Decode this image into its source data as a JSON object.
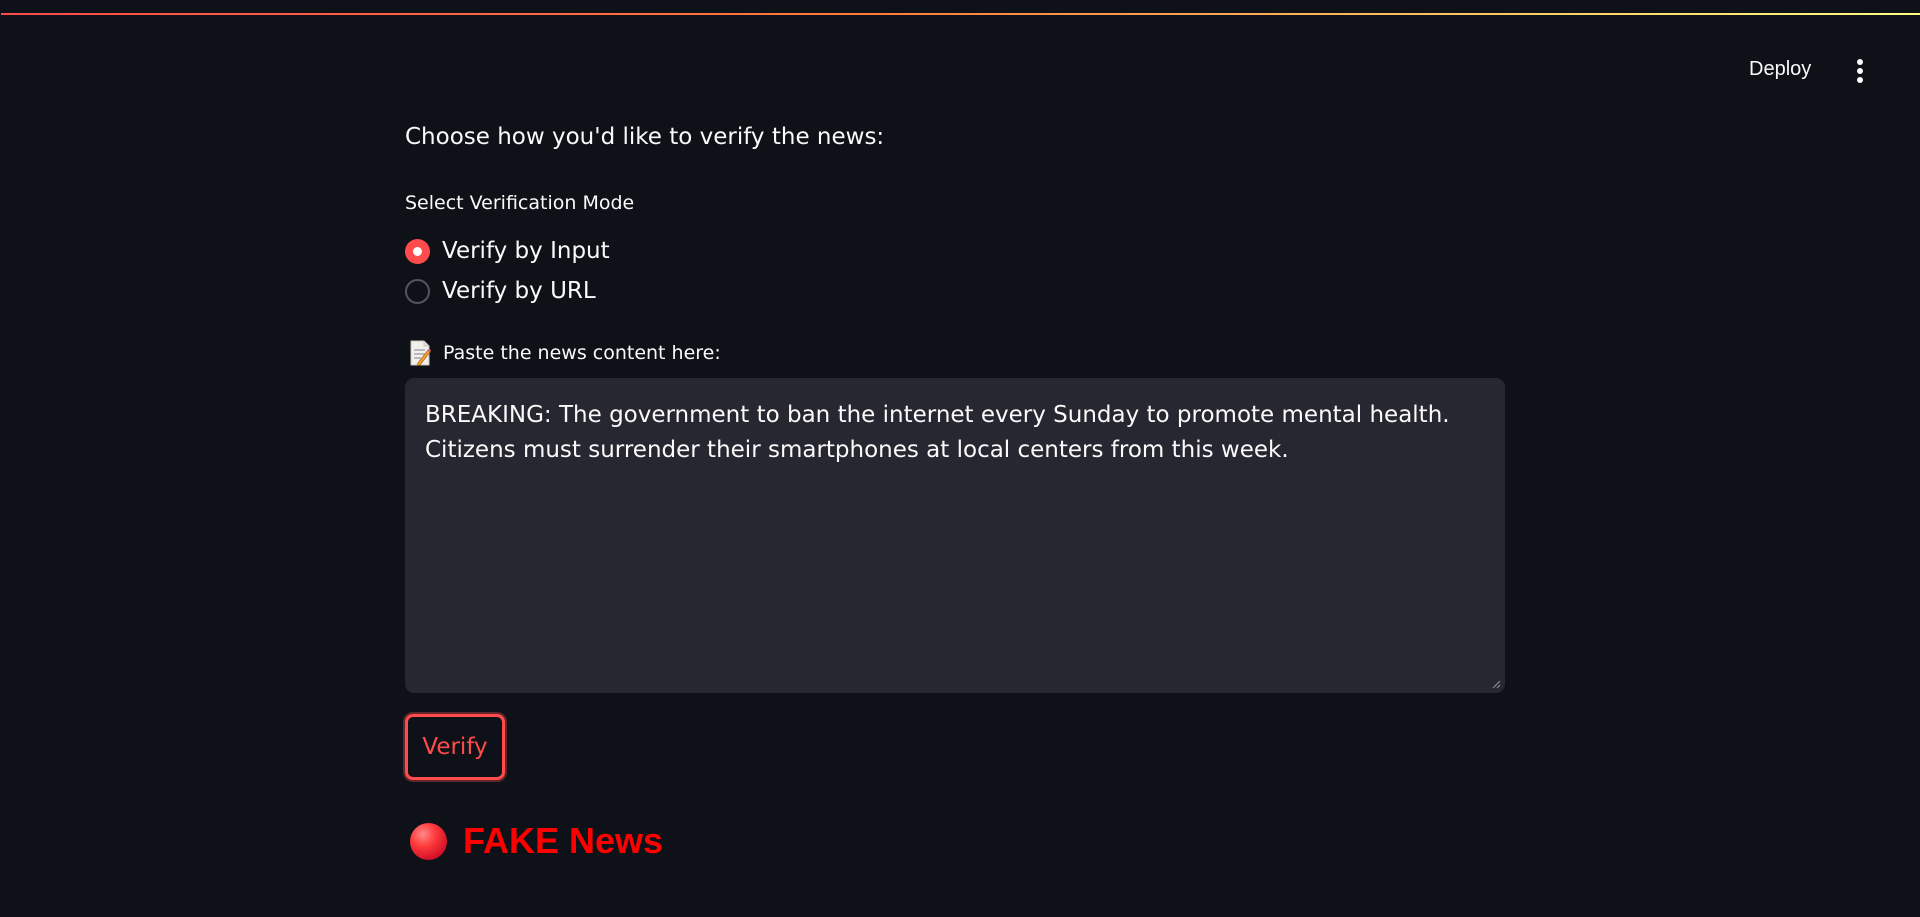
{
  "header": {
    "deploy_label": "Deploy",
    "menu_icon": "kebab-menu-icon"
  },
  "main": {
    "intro_text": "Choose how you'd like to verify the news:",
    "mode_label": "Select Verification Mode",
    "modes": [
      {
        "label": "Verify by Input",
        "selected": true
      },
      {
        "label": "Verify by URL",
        "selected": false
      }
    ],
    "paste_icon": "memo-icon",
    "paste_label": "Paste the news content here:",
    "news_content": "BREAKING: The government to ban the internet every Sunday to promote mental health. Citizens must surrender their smartphones at local centers from this week.",
    "verify_label": "Verify",
    "result": {
      "icon": "red-circle-icon",
      "text": "FAKE News",
      "color": "#ff0000"
    }
  },
  "theme": {
    "background": "#0e1117",
    "accent": "#ff4b4b",
    "input_background": "#262730",
    "text": "#fafafa"
  }
}
